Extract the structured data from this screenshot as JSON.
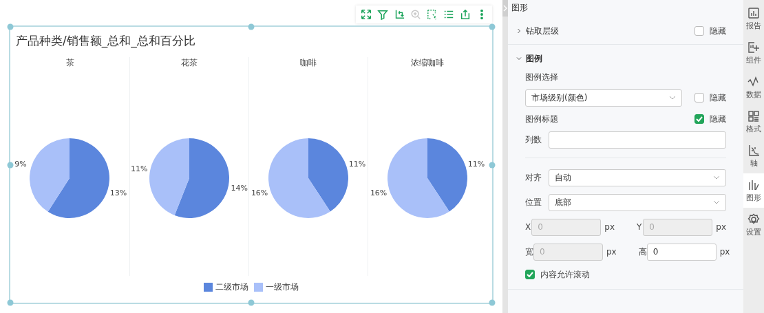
{
  "toolbar": [
    {
      "kind": "expand",
      "disabled": false
    },
    {
      "kind": "filter",
      "disabled": false
    },
    {
      "kind": "pivot",
      "disabled": false
    },
    {
      "kind": "zoom",
      "disabled": true
    },
    {
      "kind": "select",
      "disabled": false
    },
    {
      "kind": "list",
      "disabled": false
    },
    {
      "kind": "export",
      "disabled": false
    },
    {
      "kind": "more",
      "disabled": false
    }
  ],
  "chart": {
    "title": "产品种类/销售额_总和_总和百分比",
    "pies": [
      {
        "chart_data": {
          "type": "pie",
          "title": "茶",
          "values": [
            13,
            9
          ],
          "value_labels": [
            "13%",
            "9%"
          ]
        }
      },
      {
        "chart_data": {
          "type": "pie",
          "title": "花茶",
          "values": [
            14,
            11
          ],
          "value_labels": [
            "14%",
            "11%"
          ]
        }
      },
      {
        "chart_data": {
          "type": "pie",
          "title": "咖啡",
          "values": [
            11,
            16
          ],
          "value_labels": [
            "11%",
            "16%"
          ]
        }
      },
      {
        "chart_data": {
          "type": "pie",
          "title": "浓缩咖啡",
          "values": [
            11,
            16
          ],
          "value_labels": [
            "11%",
            "16%"
          ]
        }
      }
    ],
    "legend": [
      {
        "label": "二级市场",
        "color": "#5b86dd"
      },
      {
        "label": "一级市场",
        "color": "#a9c0f9"
      }
    ]
  },
  "panel": {
    "title": "图形",
    "drill": {
      "label": "钻取层级",
      "expanded": false,
      "hide": {
        "label": "隐藏",
        "checked": false
      }
    },
    "legend_section": {
      "label": "图例",
      "expanded": true,
      "select_label": "图例选择",
      "select_value": "市场级别(颜色)",
      "select_hide": {
        "label": "隐藏",
        "checked": false
      },
      "title_label": "图例标题",
      "title_hide": {
        "label": "隐藏",
        "checked": true
      },
      "columns_label": "列数",
      "align": {
        "label": "对齐",
        "value": "自动"
      },
      "position": {
        "label": "位置",
        "value": "底部"
      },
      "coords": [
        [
          {
            "label": "X",
            "value": "0",
            "unit": "px",
            "disabled": true
          },
          {
            "label": "Y",
            "value": "0",
            "unit": "px",
            "disabled": true
          }
        ],
        [
          {
            "label": "宽",
            "value": "0",
            "unit": "px",
            "disabled": true
          },
          {
            "label": "高",
            "value": "0",
            "unit": "px",
            "disabled": false
          }
        ]
      ],
      "scroll": {
        "label": "内容允许滚动",
        "checked": true
      }
    }
  },
  "rail": [
    {
      "label": "报告",
      "selected": false
    },
    {
      "label": "组件",
      "selected": false
    },
    {
      "label": "数据",
      "selected": false
    },
    {
      "label": "格式",
      "selected": false
    },
    {
      "label": "轴",
      "selected": false
    },
    {
      "label": "图形",
      "selected": true
    },
    {
      "label": "设置",
      "selected": false
    }
  ]
}
